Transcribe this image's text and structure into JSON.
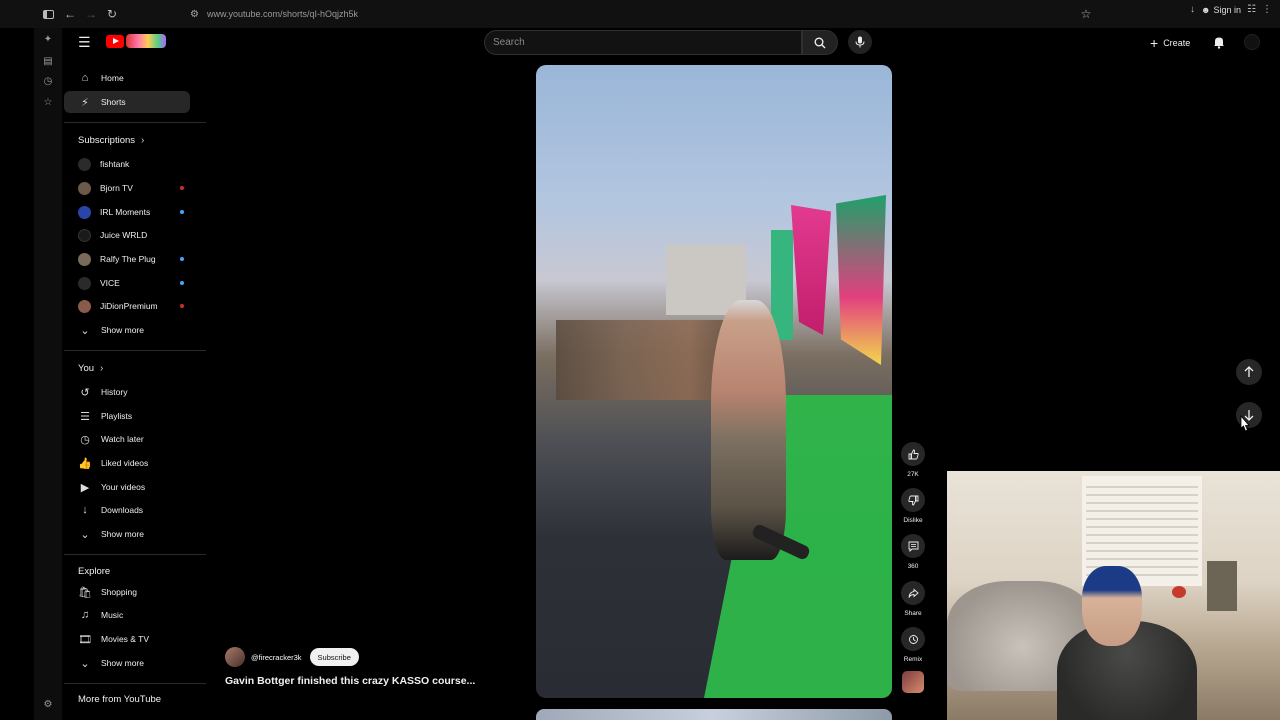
{
  "browser": {
    "url": "www.youtube.com/shorts/qI-hOqjzh5k",
    "signin_label": "Sign in"
  },
  "header": {
    "search_placeholder": "Search",
    "create_label": "Create"
  },
  "sidebar": {
    "main": [
      {
        "label": "Home",
        "icon": "home-icon"
      },
      {
        "label": "Shorts",
        "icon": "shorts-icon",
        "active": true
      }
    ],
    "subscriptions_heading": "Subscriptions",
    "subscriptions": [
      {
        "label": "fishtank",
        "color": "#2b2b2b",
        "live": ""
      },
      {
        "label": "Bjorn TV",
        "color": "#6b5a4a",
        "live": "#c4302b"
      },
      {
        "label": "IRL Moments",
        "color": "#2a44a8",
        "live": "#3ea6ff"
      },
      {
        "label": "Juice WRLD",
        "color": "#1a1a1a",
        "live": ""
      },
      {
        "label": "Ralfy The Plug",
        "color": "#7a6a5a",
        "live": "#3ea6ff"
      },
      {
        "label": "VICE",
        "color": "#2a2a2a",
        "live": "#3ea6ff"
      },
      {
        "label": "JiDionPremium",
        "color": "#8a5a4a",
        "live": "#c4302b"
      }
    ],
    "subs_show_more": "Show more",
    "you_heading": "You",
    "you_items": [
      {
        "label": "History",
        "icon": "history-icon"
      },
      {
        "label": "Playlists",
        "icon": "playlists-icon"
      },
      {
        "label": "Watch later",
        "icon": "watch-later-icon"
      },
      {
        "label": "Liked videos",
        "icon": "thumbs-up-icon"
      },
      {
        "label": "Your videos",
        "icon": "your-videos-icon"
      },
      {
        "label": "Downloads",
        "icon": "download-icon"
      }
    ],
    "you_show_more": "Show more",
    "explore_heading": "Explore",
    "explore_items": [
      {
        "label": "Shopping",
        "icon": "shopping-icon"
      },
      {
        "label": "Music",
        "icon": "music-icon"
      },
      {
        "label": "Movies & TV",
        "icon": "movies-icon"
      }
    ],
    "explore_show_more": "Show more",
    "more_heading": "More from YouTube"
  },
  "short": {
    "channel_handle": "@firecracker3k",
    "subscribe_label": "Subscribe",
    "title": "Gavin Bottger finished this crazy KASSO course...",
    "actions": {
      "like_count": "27K",
      "dislike_label": "Dislike",
      "comments_count": "360",
      "share_label": "Share",
      "remix_label": "Remix"
    }
  }
}
